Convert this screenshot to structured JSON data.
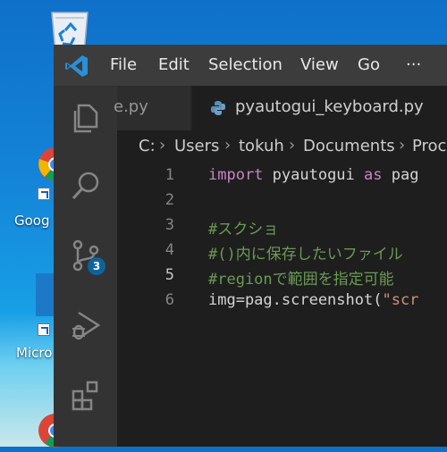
{
  "desktop": {
    "icons": [
      {
        "label": "",
        "icon": "recycle-bin-icon"
      },
      {
        "label": "Goog",
        "icon": "chrome-icon"
      },
      {
        "label": "Micro",
        "icon": "edge-icon"
      }
    ]
  },
  "titlebar": {
    "menu": [
      "File",
      "Edit",
      "Selection",
      "View",
      "Go",
      "···"
    ]
  },
  "tabs": [
    {
      "label": "e.py",
      "active": false
    },
    {
      "label": "pyautogui_keyboard.py",
      "active": true
    }
  ],
  "breadcrumb": [
    "C:",
    "Users",
    "tokuh",
    "Documents",
    "Proc"
  ],
  "activitybar": {
    "badge": "3"
  },
  "editor": {
    "lines": [
      {
        "num": "1",
        "tokens": [
          {
            "t": "import",
            "c": "#c586c0"
          },
          {
            "t": " pyautogui ",
            "c": "#d4d4d4"
          },
          {
            "t": "as",
            "c": "#c586c0"
          },
          {
            "t": " pag",
            "c": "#d4d4d4"
          }
        ]
      },
      {
        "num": "2",
        "tokens": []
      },
      {
        "num": "3",
        "tokens": [
          {
            "t": "#スクショ",
            "c": "#6a9955"
          }
        ]
      },
      {
        "num": "4",
        "tokens": [
          {
            "t": "#()内に保存したいファイル",
            "c": "#6a9955"
          }
        ]
      },
      {
        "num": "5",
        "tokens": [
          {
            "t": "#regionで範囲を指定可能",
            "c": "#6a9955"
          }
        ]
      },
      {
        "num": "6",
        "tokens": [
          {
            "t": "img=pag.screenshot(",
            "c": "#d4d4d4"
          },
          {
            "t": "\"scr",
            "c": "#ce9178"
          }
        ]
      }
    ]
  },
  "colors": {
    "titlebar": "#3c3c3c",
    "activitybar": "#333333",
    "editor_bg": "#1e1e1e",
    "badge": "#0e639c"
  }
}
